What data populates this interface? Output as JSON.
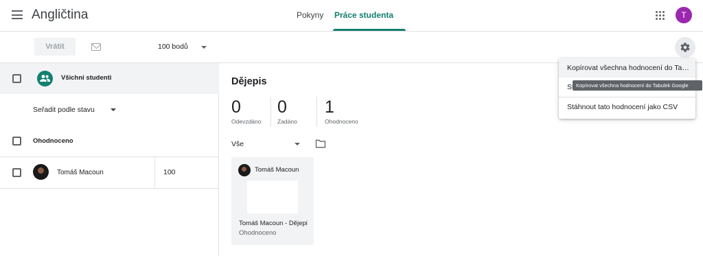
{
  "header": {
    "title": "Angličtina",
    "tabs": [
      {
        "label": "Pokyny",
        "active": false
      },
      {
        "label": "Práce studenta",
        "active": true
      }
    ],
    "avatar_letter": "T"
  },
  "toolbar": {
    "return_label": "Vrátit",
    "points_value": "100 bodů"
  },
  "left_panel": {
    "all_students_label": "Všichni studenti",
    "sort_label": "Seřadit podle stavu",
    "graded_section_label": "Ohodnoceno",
    "students": [
      {
        "name": "Tomáš Macoun",
        "grade": "100"
      }
    ]
  },
  "main": {
    "assignment_title": "Dějepis",
    "stats": [
      {
        "value": "0",
        "label": "Odevzdáno"
      },
      {
        "value": "0",
        "label": "Zadáno"
      },
      {
        "value": "1",
        "label": "Ohodnoceno"
      }
    ],
    "filter_value": "Vše",
    "cards": [
      {
        "student": "Tomáš Macoun",
        "title": "Tomáš Macoun - Dějepis",
        "status": "Ohodnoceno"
      }
    ]
  },
  "settings_menu": {
    "items": [
      "Kopírovat všechna hodnocení do Tabulek Google",
      "St",
      "Stáhnout tato hodnocení jako CSV"
    ],
    "tooltip": "Kopírovat všechna hodnocení do Tabulek Google"
  },
  "colors": {
    "accent": "#137f70",
    "avatar_bg": "#9c27b0"
  },
  "icons": [
    "menu-icon",
    "apps-icon",
    "mail-icon",
    "chevron-down-icon",
    "settings-gear-icon",
    "group-icon",
    "folder-icon"
  ]
}
